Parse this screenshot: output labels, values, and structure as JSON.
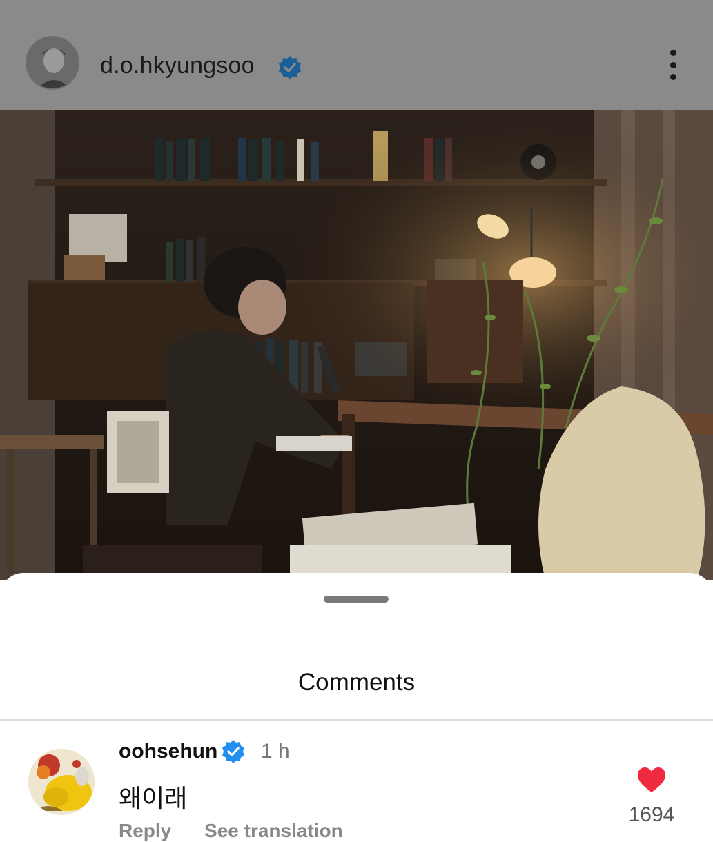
{
  "post": {
    "username": "d.o.hkyungsoo",
    "verified": true,
    "more_icon": "more-vertical-icon",
    "image_description_icon": "photo"
  },
  "comments_sheet": {
    "title": "Comments",
    "comments": [
      {
        "username": "oohsehun",
        "verified": true,
        "time": "1 h",
        "text": "왜이래",
        "likes": "1694",
        "reply_label": "Reply",
        "translation_label": "See translation"
      }
    ]
  },
  "colors": {
    "verified_blue": "#1f8ff0",
    "like_red": "#ef2a3e",
    "header_dim": "#8a8a8a"
  }
}
